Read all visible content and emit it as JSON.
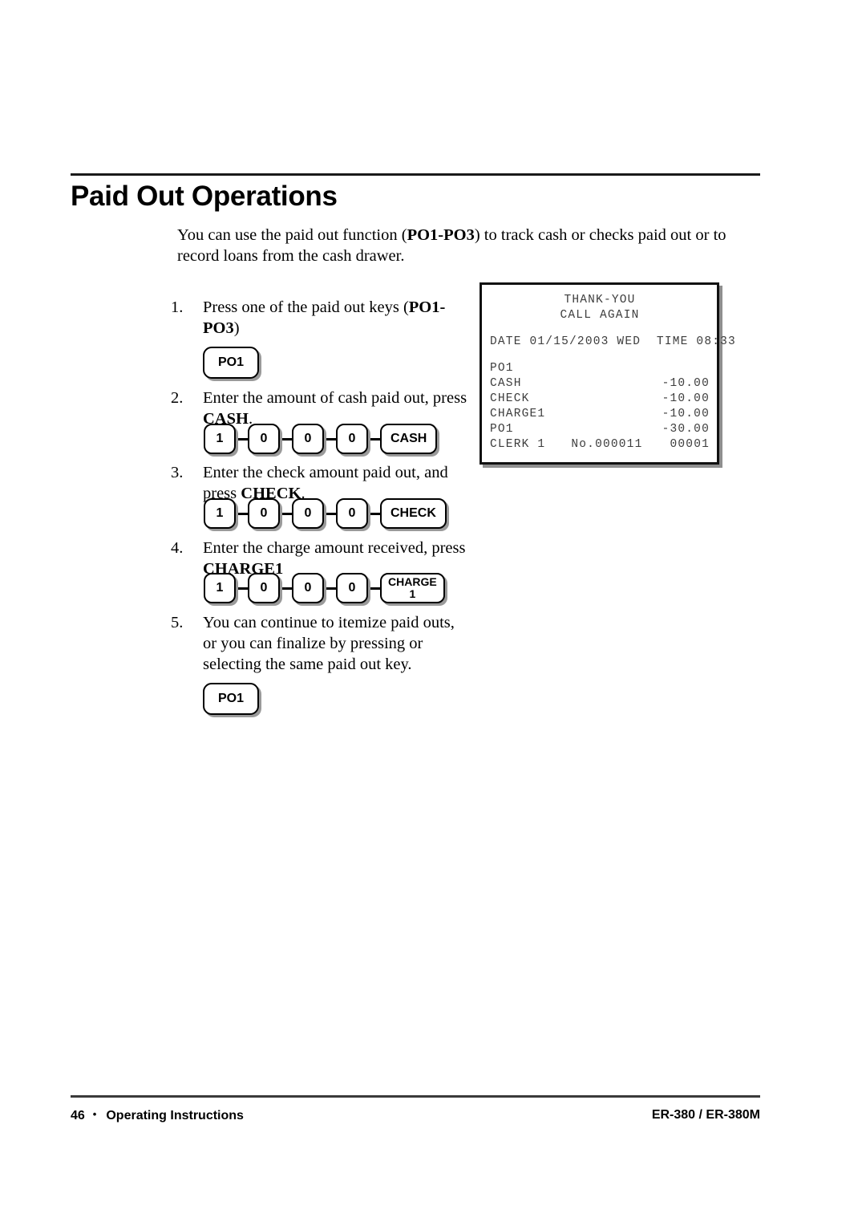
{
  "page": {
    "title": "Paid Out Operations",
    "intro_before": "You can use the paid out function (",
    "intro_bold": "PO1-PO3",
    "intro_after": ") to track cash or checks paid out or to record loans from the cash drawer."
  },
  "steps": [
    {
      "number": "1.",
      "text_before": "Press one of the paid out keys (",
      "text_bold": "PO1-PO3",
      "text_after": ")",
      "keys": [
        "PO1"
      ]
    },
    {
      "number": "2.",
      "text_before": "Enter the amount of cash paid out, press ",
      "text_bold": "CASH",
      "text_after": ".",
      "keys": [
        "1",
        "0",
        "0",
        "0",
        "CASH"
      ]
    },
    {
      "number": "3.",
      "text_before": "Enter the check amount paid out, and press ",
      "text_bold": "CHECK",
      "text_after": ".",
      "keys": [
        "1",
        "0",
        "0",
        "0",
        "CHECK"
      ]
    },
    {
      "number": "4.",
      "text_before": "Enter the charge amount received, press ",
      "text_bold": "CHARGE1",
      "text_after": "",
      "keys": [
        "1",
        "0",
        "0",
        "0",
        "CHARGE 1"
      ]
    },
    {
      "number": "5.",
      "text_before": "You can continue to itemize paid outs, or you can finalize by pressing or selecting the same paid out key.",
      "text_bold": "",
      "text_after": "",
      "keys": [
        "PO1"
      ]
    }
  ],
  "keys": {
    "po1": "PO1",
    "digit_1": "1",
    "digit_0": "0",
    "cash": "CASH",
    "check": "CHECK",
    "charge_line1": "CHARGE",
    "charge_line2": "1"
  },
  "receipt": {
    "header_line1": "THANK-YOU",
    "header_line2": "CALL AGAIN",
    "datetime_line": "DATE 01/15/2003 WED  TIME 08:33",
    "po_header": "PO1",
    "rows": [
      {
        "label": "CASH",
        "amount": "-10.00"
      },
      {
        "label": "CHECK",
        "amount": "-10.00"
      },
      {
        "label": "CHARGE1",
        "amount": "-10.00"
      },
      {
        "label": "PO1",
        "amount": "-30.00"
      }
    ],
    "footer": {
      "clerk": "CLERK 1",
      "consecutive": "No.000011",
      "counter": "00001"
    }
  },
  "footer": {
    "page_number": "46",
    "bullet": "•",
    "section": "Operating Instructions",
    "model": "ER-380 / ER-380M"
  }
}
